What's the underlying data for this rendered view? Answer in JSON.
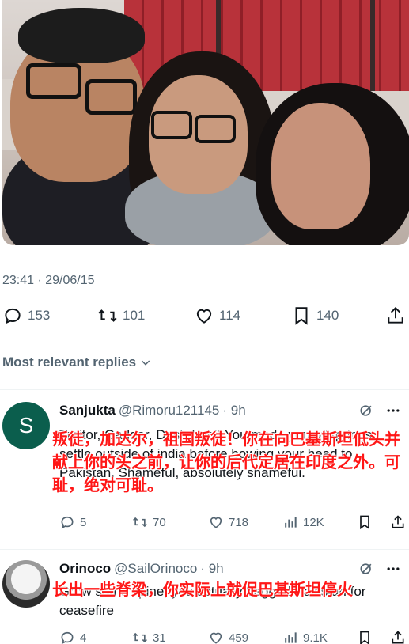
{
  "tweet": {
    "timestamp": "23:41 · 29/06/15",
    "stats": {
      "replies": "153",
      "reposts": "101",
      "likes": "114",
      "bookmarks": "140"
    }
  },
  "replies_section": {
    "label": "Most relevant replies"
  },
  "replies": [
    {
      "avatar_letter": "S",
      "name": "Sanjukta",
      "handle": "@Rimoru121145",
      "time": "· 9h",
      "text": "Traitor, Gaddar, Deshdrohi! You made you offsprings settle outside of india before bowing your head to Pakistan. Shameful, absolutely shameful.",
      "overlay": "叛徒，加达尔，祖国叛徒！你在向巴基斯坦低头并献上你的头之前，让你的后代定居在印度之外。可耻，绝对可耻。",
      "actions": {
        "replies": "5",
        "reposts": "70",
        "likes": "718",
        "views": "12K"
      }
    },
    {
      "name": "Orinoco",
      "handle": "@SailOrinoco",
      "time": "· 9h",
      "text": "Grow some spine, you actually begged Pakistan for ceasefire",
      "overlay": "长出一些脊梁，你实际上就促巴基斯坦停火",
      "actions": {
        "replies": "4",
        "reposts": "31",
        "likes": "459",
        "views": "9.1K"
      }
    }
  ],
  "icons": [
    "reply-icon",
    "repost-icon",
    "like-icon",
    "bookmark-icon",
    "share-icon",
    "grok-icon",
    "more-icon",
    "views-icon",
    "chevron-down-icon"
  ],
  "colors": {
    "text": "#0f1419",
    "muted": "#536471",
    "overlay_red": "#ff1616",
    "avatar_green": "#0b5e4d"
  }
}
